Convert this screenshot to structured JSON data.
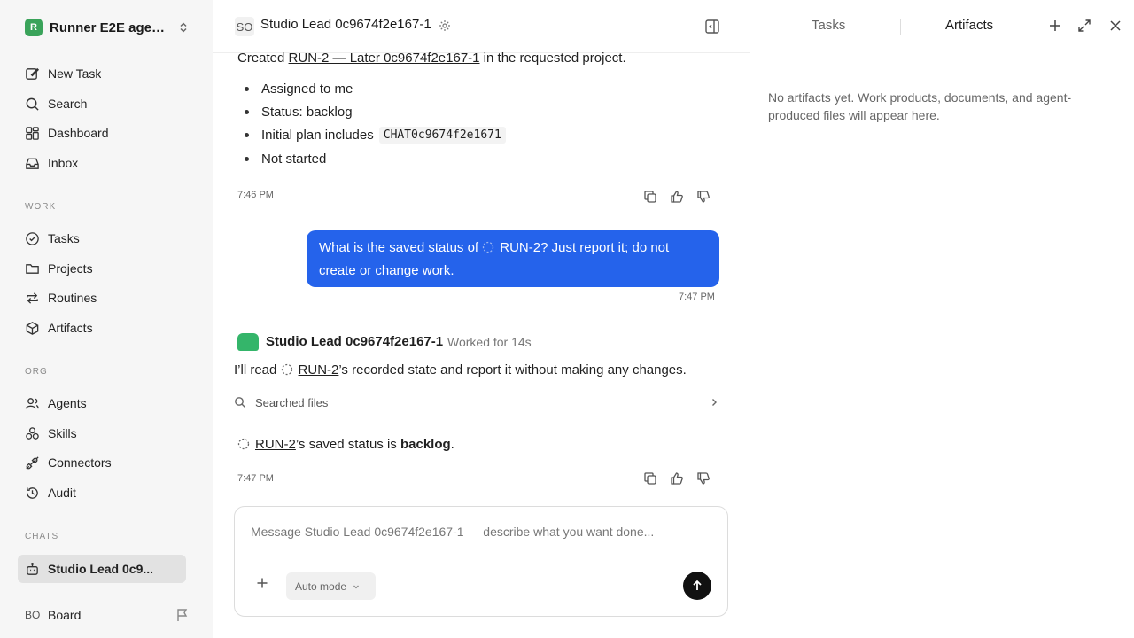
{
  "workspace": {
    "logo": "R",
    "name": "Runner E2E agen..."
  },
  "nav_main": [
    {
      "label": "New Task",
      "icon": "edit-icon"
    },
    {
      "label": "Search",
      "icon": "search-icon"
    },
    {
      "label": "Dashboard",
      "icon": "dashboard-icon"
    },
    {
      "label": "Inbox",
      "icon": "inbox-icon"
    }
  ],
  "sections": {
    "work": "WORK",
    "org": "ORG",
    "chats": "CHATS"
  },
  "nav_work": [
    {
      "label": "Tasks",
      "icon": "check-circle-icon"
    },
    {
      "label": "Projects",
      "icon": "folder-icon"
    },
    {
      "label": "Routines",
      "icon": "repeat-icon"
    },
    {
      "label": "Artifacts",
      "icon": "box-icon"
    }
  ],
  "nav_org": [
    {
      "label": "Agents",
      "icon": "users-icon"
    },
    {
      "label": "Skills",
      "icon": "skills-icon"
    },
    {
      "label": "Connectors",
      "icon": "plug-icon"
    },
    {
      "label": "Audit",
      "icon": "history-icon"
    }
  ],
  "chats": [
    {
      "label": "Studio Lead 0c9...",
      "icon": "bot-icon",
      "active": true
    }
  ],
  "user": {
    "initials": "BO",
    "name": "Board"
  },
  "chat_header": {
    "badge": "SO",
    "title": "Studio Lead 0c9674f2e167-1"
  },
  "messages": {
    "m1": {
      "prefix": "Created ",
      "link": "RUN-2 — Later 0c9674f2e167-1",
      "suffix": " in the requested project.",
      "bullets": [
        "Assigned to me",
        "Status: backlog",
        "Initial plan includes",
        "Not started"
      ],
      "code": "CHAT0c9674f2e1671",
      "time": "7:46 PM"
    },
    "user_msg": {
      "prefix": "What is the saved status of ",
      "link": "RUN-2",
      "suffix": "? Just report it; do not create or change work.",
      "time": "7:47 PM"
    },
    "m3": {
      "sender": "Studio Lead 0c9674f2e167-1",
      "worked": "Worked for 14s",
      "line_prefix": "I’ll read ",
      "line_link": "RUN-2",
      "line_suffix": "’s recorded state and report it without making any changes.",
      "tool": "Searched files",
      "answer_link": "RUN-2",
      "answer_mid": "’s saved status is ",
      "answer_bold": "backlog",
      "answer_end": ".",
      "time": "7:47 PM"
    }
  },
  "composer": {
    "placeholder": "Message Studio Lead 0c9674f2e167-1 — describe what you want done...",
    "mode": "Auto mode"
  },
  "right_panel": {
    "tabs": [
      "Tasks",
      "Artifacts"
    ],
    "active_tab": "Artifacts",
    "empty_text": "No artifacts yet. Work products, documents, and agent-produced files will appear here."
  }
}
